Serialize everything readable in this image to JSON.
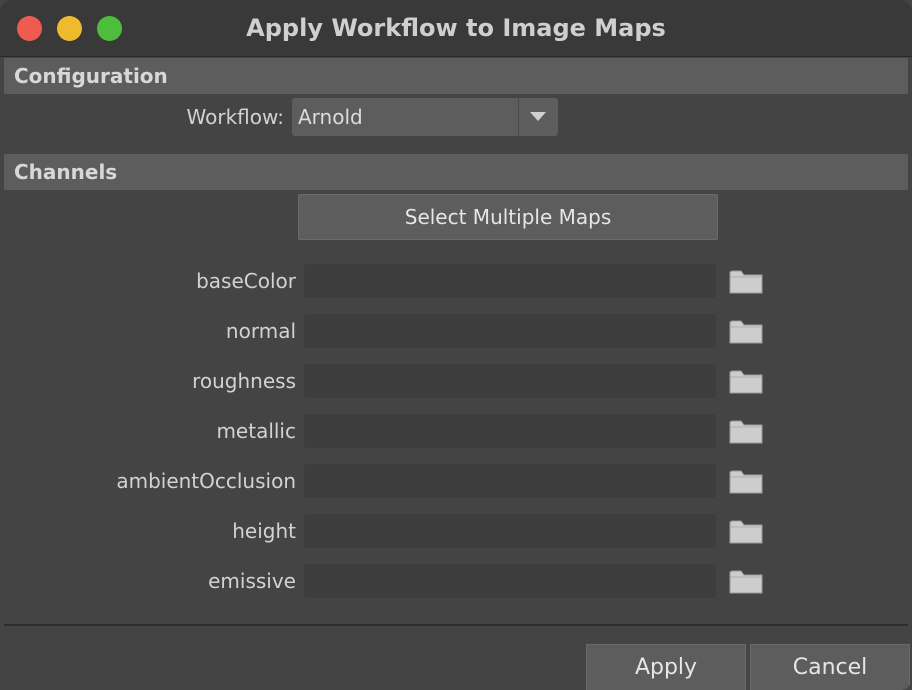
{
  "window": {
    "title": "Apply Workflow to Image Maps"
  },
  "configuration": {
    "header": "Configuration",
    "workflow_label": "Workflow:",
    "workflow_value": "Arnold"
  },
  "channels": {
    "header": "Channels",
    "select_multiple_label": "Select Multiple Maps",
    "items": [
      {
        "label": "baseColor",
        "value": ""
      },
      {
        "label": "normal",
        "value": ""
      },
      {
        "label": "roughness",
        "value": ""
      },
      {
        "label": "metallic",
        "value": ""
      },
      {
        "label": "ambientOcclusion",
        "value": ""
      },
      {
        "label": "height",
        "value": ""
      },
      {
        "label": "emissive",
        "value": ""
      }
    ]
  },
  "footer": {
    "apply_label": "Apply",
    "cancel_label": "Cancel"
  },
  "icons": {
    "folder": "folder-icon",
    "dropdown": "chevron-down-icon"
  },
  "colors": {
    "close": "#ee5b50",
    "minimize": "#efbb2e",
    "maximize": "#4fbd3c"
  }
}
